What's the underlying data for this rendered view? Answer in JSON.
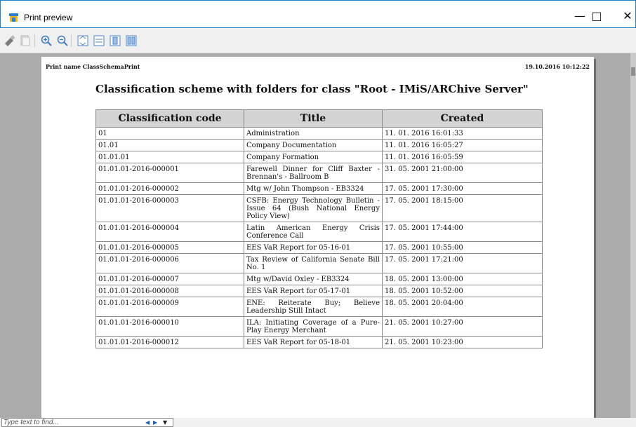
{
  "window": {
    "title": "Print preview"
  },
  "toolbar": {
    "buttons": [
      "print-icon",
      "page-setup-icon",
      "zoom-in-icon",
      "zoom-out-icon",
      "fit-page-icon",
      "fit-width-icon",
      "single-page-icon",
      "two-pages-icon"
    ]
  },
  "page": {
    "print_name": "Print name ClassSchemaPrint",
    "print_date": "19.10.2016 10:12:22",
    "title": "Classification scheme with folders for class \"Root - IMiS/ARChive Server\""
  },
  "table": {
    "headers": [
      "Classification code",
      "Title",
      "Created"
    ],
    "rows": [
      {
        "code": "01",
        "title": "Administration",
        "created": "11. 01. 2016 16:01:33"
      },
      {
        "code": "01.01",
        "title": "Company Documentation",
        "created": "11. 01. 2016 16:05:27"
      },
      {
        "code": "01.01.01",
        "title": "Company Formation",
        "created": "11. 01. 2016 16:05:59"
      },
      {
        "code": "01.01.01-2016-000001",
        "title": "Farewell Dinner for Cliff Baxter - Brennan's - Ballroom B",
        "created": "31. 05. 2001 21:00:00"
      },
      {
        "code": "01.01.01-2016-000002",
        "title": "Mtg w/ John Thompson - EB3324",
        "created": "17. 05. 2001 17:30:00"
      },
      {
        "code": "01.01.01-2016-000003",
        "title": "CSFB: Energy Technology Bulletin - Issue 64 (Bush National Energy Policy View)",
        "created": "17. 05. 2001 18:15:00"
      },
      {
        "code": "01.01.01-2016-000004",
        "title": "Latin American Energy Crisis Conference Call",
        "created": "17. 05. 2001 17:44:00"
      },
      {
        "code": "01.01.01-2016-000005",
        "title": "EES VaR Report for 05-16-01",
        "created": "17. 05. 2001 10:55:00"
      },
      {
        "code": "01.01.01-2016-000006",
        "title": "Tax Review of California Senate Bill No. 1",
        "created": "17. 05. 2001 17:21:00"
      },
      {
        "code": "01.01.01-2016-000007",
        "title": "Mtg w/David Oxley - EB3324",
        "created": "18. 05. 2001 13:00:00"
      },
      {
        "code": "01.01.01-2016-000008",
        "title": "EES VaR Report for 05-17-01",
        "created": "18. 05. 2001 10:52:00"
      },
      {
        "code": "01.01.01-2016-000009",
        "title": "ENE: Reiterate Buy; Believe Leadership Still Intact",
        "created": "18. 05. 2001 20:04:00"
      },
      {
        "code": "01.01.01-2016-000010",
        "title": "ILA: Initiating Coverage of a Pure-Play Energy Merchant",
        "created": "21. 05. 2001 10:27:00"
      },
      {
        "code": "01.01.01-2016-000012",
        "title": "EES VaR Report for 05-18-01",
        "created": "21. 05. 2001 10:23:00"
      }
    ]
  },
  "find": {
    "placeholder": "Type text to find...",
    "prev_icon": "◀",
    "next_icon": "▶",
    "options_icon": "▼"
  }
}
